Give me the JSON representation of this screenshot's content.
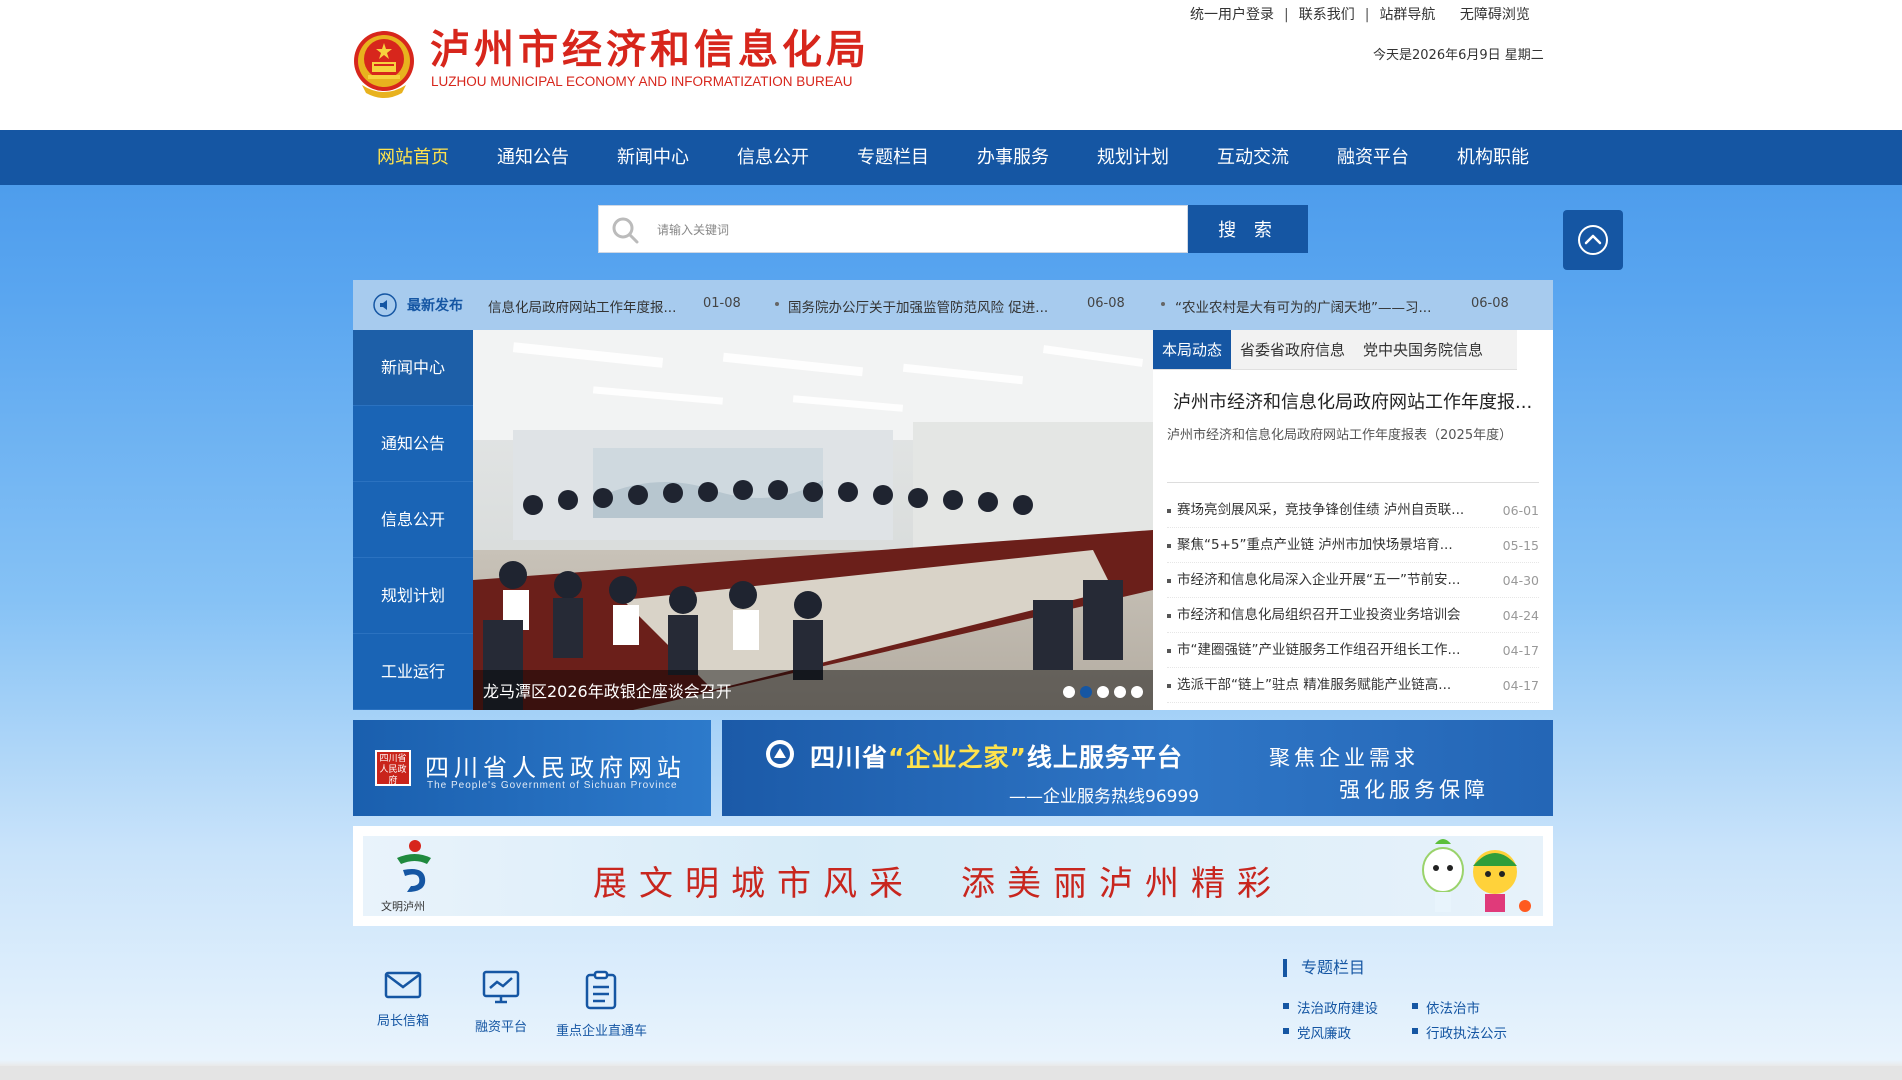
{
  "header": {
    "title_cn": "泸州市经济和信息化局",
    "title_en": "LUZHOU MUNICIPAL ECONOMY AND INFORMATIZATION BUREAU",
    "top_links": [
      "统一用户登录",
      "联系我们",
      "站群导航",
      "无障碍浏览"
    ],
    "date_text": "今天是2026年6月9日 星期二"
  },
  "nav": {
    "items": [
      "网站首页",
      "通知公告",
      "新闻中心",
      "信息公开",
      "专题栏目",
      "办事服务",
      "规划计划",
      "互动交流",
      "融资平台",
      "机构职能"
    ],
    "active_index": 0
  },
  "search": {
    "placeholder": "请输入关键词",
    "button": "搜 索"
  },
  "ticker": {
    "label": "最新发布",
    "items": [
      {
        "text": "信息化局政府网站工作年度报...",
        "date": "01-08"
      },
      {
        "text": "国务院办公厅关于加强监管防范风险 促进...",
        "date": "06-08"
      },
      {
        "text": "“农业农村是大有可为的广阔天地”——习...",
        "date": "06-08"
      }
    ]
  },
  "side_menu": [
    "新闻中心",
    "通知公告",
    "信息公开",
    "规划计划",
    "工业运行"
  ],
  "slider": {
    "caption": "龙马潭区2026年政银企座谈会召开",
    "slide_count": 5,
    "active_index": 1
  },
  "news_panel": {
    "tabs": [
      "本局动态",
      "省委省政府信息",
      "党中央国务院信息"
    ],
    "active_tab": 0,
    "featured_title": "泸州市经济和信息化局政府网站工作年度报...",
    "featured_sub": "泸州市经济和信息化局政府网站工作年度报表（2025年度）",
    "items": [
      {
        "text": "赛场亮剑展风采，竞技争锋创佳绩 泸州自贡联...",
        "date": "06-01"
      },
      {
        "text": "聚焦“5+5”重点产业链 泸州市加快场景培育...",
        "date": "05-15"
      },
      {
        "text": "市经济和信息化局深入企业开展“五一”节前安...",
        "date": "04-30"
      },
      {
        "text": "市经济和信息化局组织召开工业投资业务培训会",
        "date": "04-24"
      },
      {
        "text": "市“建圈强链”产业链服务工作组召开组长工作...",
        "date": "04-17"
      },
      {
        "text": "选派干部“链上”驻点 精准服务赋能产业链高...",
        "date": "04-17"
      }
    ]
  },
  "banners": {
    "gov": {
      "cn": "四川省人民政府网站",
      "en": "The People's Government of Sichuan Province",
      "seal": "四川省人民政府"
    },
    "enterprise": {
      "title_pre": "四川省",
      "title_quote": "“企业之家”",
      "title_post": "线上服务平台",
      "hotline": "——企业服务热线96999",
      "slogan_1": "聚焦企业需求",
      "slogan_2": "强化服务保障"
    },
    "civilization": {
      "text": "展文明城市风采　添美丽泸州精彩",
      "logo_caption": "文明泸州"
    }
  },
  "shortcuts": [
    "局长信箱",
    "融资平台",
    "重点企业直通车"
  ],
  "topics": {
    "title": "专题栏目",
    "links": [
      "法治政府建设",
      "依法治市",
      "党风廉政",
      "行政执法公示"
    ]
  },
  "colors": {
    "primary": "#1556a3",
    "title_red": "#d7261c",
    "nav_active": "#ffe34d"
  }
}
